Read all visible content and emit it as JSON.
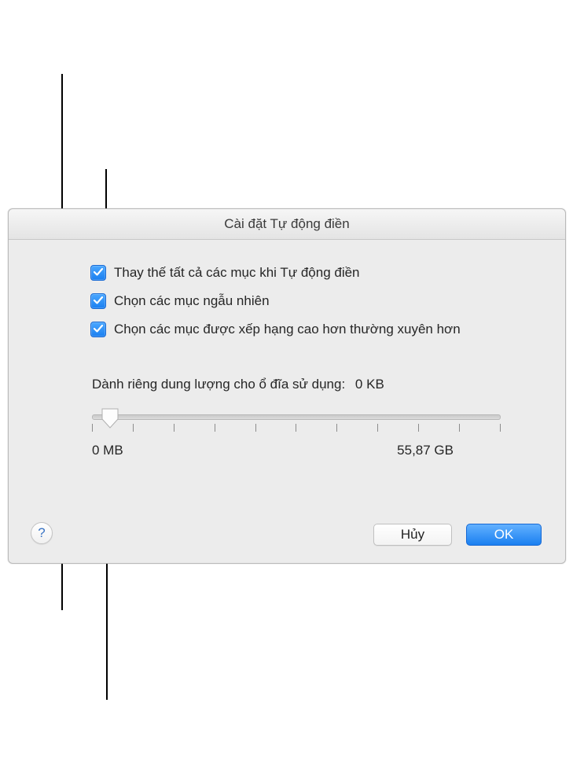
{
  "dialog": {
    "title": "Cài đặt Tự động điền",
    "checkboxes": [
      {
        "label": "Thay thế tất cả các mục khi Tự động điền"
      },
      {
        "label": "Chọn các mục ngẫu nhiên"
      },
      {
        "label": "Chọn các mục được xếp hạng cao hơn thường xuyên hơn"
      }
    ],
    "reserve_label": "Dành riêng dung lượng cho ổ đĩa sử dụng:",
    "reserve_value": "0 KB",
    "slider_min_label": "0 MB",
    "slider_max_label": "55,87 GB",
    "cancel_label": "Hủy",
    "ok_label": "OK",
    "help_symbol": "?"
  }
}
